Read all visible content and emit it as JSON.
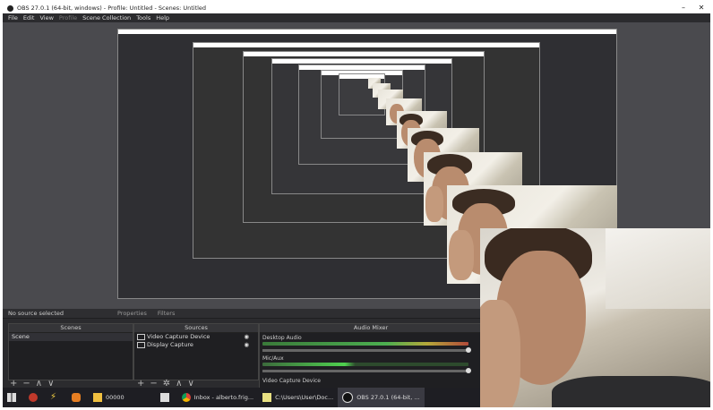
{
  "window": {
    "title": "OBS 27.0.1 (64-bit, windows) - Profile: Untitled - Scenes: Untitled",
    "minimize": "–",
    "close": "✕"
  },
  "menu": [
    "File",
    "Edit",
    "View",
    "Profile",
    "Scene Collection",
    "Tools",
    "Help"
  ],
  "status": {
    "no_source": "No source selected",
    "properties": "Properties",
    "filters": "Filters"
  },
  "scenes": {
    "header": "Scenes",
    "items": [
      "Scene"
    ]
  },
  "sources": {
    "header": "Sources",
    "items": [
      "Video Capture Device",
      "Display Capture"
    ]
  },
  "mixer": {
    "header": "Audio Mixer",
    "tracks": [
      {
        "name": "Desktop Audio",
        "level": 0.9
      },
      {
        "name": "Mic/Aux",
        "level": 0.35
      }
    ],
    "footer": "Video Capture Device"
  },
  "taskbar": [
    {
      "label": "",
      "icon": "windows-icon"
    },
    {
      "label": "",
      "icon": "app-icon-red"
    },
    {
      "label": "",
      "icon": "app-icon-lightning"
    },
    {
      "label": "",
      "icon": "app-icon-rocket"
    },
    {
      "label": "00000",
      "icon": "folder-icon"
    },
    {
      "label": "",
      "icon": "photos-icon"
    },
    {
      "label": "Inbox - alberto.frig...",
      "icon": "chrome-icon"
    },
    {
      "label": "C:\\Users\\User\\Doc...",
      "icon": "notepad-icon"
    },
    {
      "label": "OBS 27.0.1 (64-bit, ...",
      "icon": "obs-icon"
    }
  ]
}
